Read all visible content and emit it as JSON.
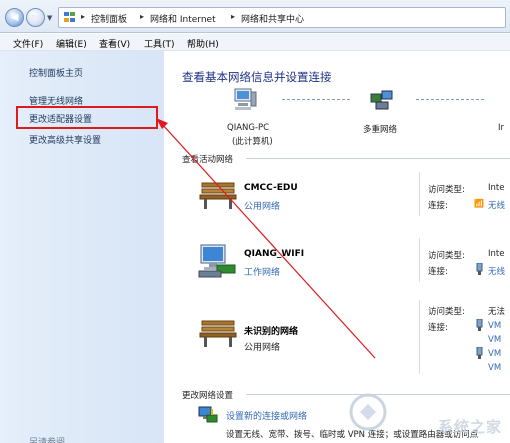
{
  "address_bar": {
    "crumbs": [
      "控制面板",
      "网络和 Internet",
      "网络和共享中心"
    ]
  },
  "menu": {
    "items": [
      "文件(F)",
      "编辑(E)",
      "查看(V)",
      "工具(T)",
      "帮助(H)"
    ]
  },
  "sidebar": {
    "items": [
      {
        "label": "控制面板主页"
      },
      {
        "label": "管理无线网络"
      },
      {
        "label": "更改适配器设置"
      },
      {
        "label": "更改高级共享设置"
      }
    ],
    "bottom_partial": "另请参阅"
  },
  "main": {
    "title": "查看基本网络信息并设置连接",
    "map": {
      "computer_label": "QIANG-PC",
      "computer_sub": "(此计算机)",
      "multi_label": "多重网络",
      "internet_label": "Ir"
    },
    "active_heading": "查看活动网络",
    "networks": [
      {
        "name": "CMCC-EDU",
        "type": "公用网络",
        "access_label": "访问类型:",
        "access_value": "Inte",
        "conn_label": "连接:",
        "conn_value": "无线"
      },
      {
        "name": "QIANG_WIFI",
        "type": "工作网络",
        "access_label": "访问类型:",
        "access_value": "Inte",
        "conn_label": "连接:",
        "conn_value": "无线"
      },
      {
        "name": "未识别的网络",
        "type": "公用网络",
        "access_label": "访问类型:",
        "access_value": "无法",
        "conn_label": "连接:",
        "conn_values": [
          "VM",
          "VM",
          "VM",
          "VM"
        ]
      }
    ],
    "change_heading": "更改网络设置",
    "tasks": [
      {
        "link": "设置新的连接或网络",
        "desc": "设置无线、宽带、拨号、临时或 VPN 连接；或设置路由器或访问点"
      }
    ]
  },
  "watermark": "系统之家",
  "colors": {
    "link": "#3369b6",
    "title": "#1e3287",
    "highlight": "#e0191d"
  }
}
